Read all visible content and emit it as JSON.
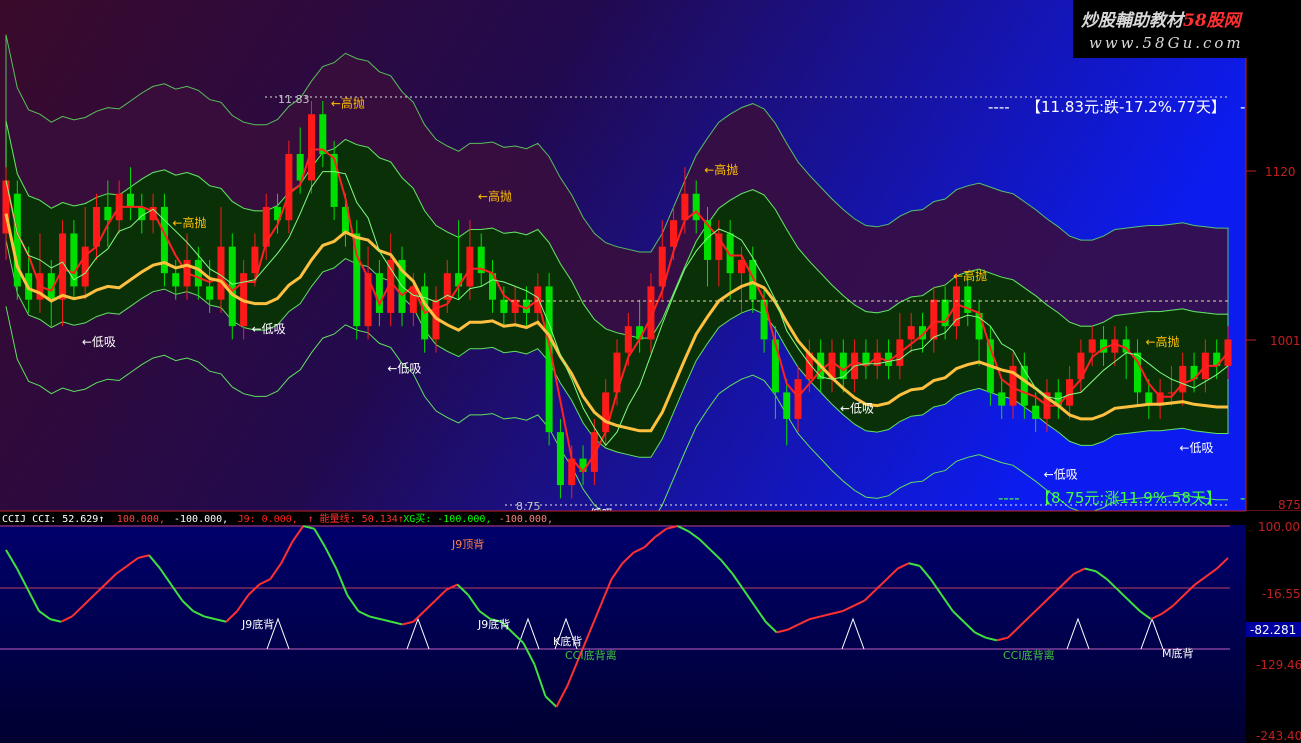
{
  "watermark": {
    "brand": "炒股輔助教材",
    "brand_accent": "58股网",
    "url": "www.58Gu.com"
  },
  "colors": {
    "up": "#ff1a1a",
    "down": "#00e000",
    "upper_band_fill": "#3a0e3c",
    "middle_band_fill": "#0a3008",
    "cci_up": "#ff3030",
    "cci_down": "#40e040",
    "ma_yellow": "#ffc040"
  },
  "main_panel": {
    "header_text": "",
    "annotations": [
      {
        "text": "11.83",
        "color": "#c0c0c0"
      },
      {
        "text": "8.75",
        "color": "#c0c0c0"
      },
      {
        "text": "高抛",
        "color": "#ffc000"
      },
      {
        "text": "低吸",
        "color": "#ffffff"
      }
    ],
    "top_marker": "【11.83元:跌-17.2%.77天】",
    "bottom_marker": "【8.75元:涨11.9%.58天】",
    "price_ticks": [
      "1120",
      "1001",
      "875"
    ]
  },
  "cci_panel": {
    "header_parts": [
      {
        "text": "CCIJ CCI: 52.629↑",
        "color": "#ffffff"
      },
      {
        "text": "100.000,",
        "color": "#ff4040"
      },
      {
        "text": "-100.000,",
        "color": "#ffffff"
      },
      {
        "text": "J9: 0.000,",
        "color": "#ff2020"
      },
      {
        "text": "↑ 能量线: 50.134↑",
        "color": "#ff3030"
      },
      {
        "text": "XG买: -100.000,",
        "color": "#00ff00"
      },
      {
        "text": "-100.000,",
        "color": "#ff8080"
      }
    ],
    "labels": [
      "J9顶背",
      "J9底背",
      "J9底背",
      "K底背",
      "CCI底背离",
      "CCI底背离",
      "M底背"
    ],
    "ticks": [
      "100.00",
      "-16.55",
      "-129.46",
      "-243.40"
    ],
    "current_value": "-82.281"
  },
  "chart_data": [
    {
      "type": "candlestick",
      "title": "",
      "y_label_ticks": [
        11.2,
        10.01,
        8.75
      ],
      "high_marker": 11.83,
      "low_marker": 8.75,
      "signals": [
        "高抛",
        "低吸"
      ],
      "candles": [
        [
          10.8,
          11.2,
          11.3,
          10.6
        ],
        [
          11.1,
          10.4,
          11.2,
          10.3
        ],
        [
          10.5,
          10.3,
          10.7,
          10.2
        ],
        [
          10.3,
          10.5,
          10.8,
          10.2
        ],
        [
          10.5,
          10.3,
          10.6,
          10.1
        ],
        [
          10.3,
          10.8,
          10.9,
          10.1
        ],
        [
          10.8,
          10.4,
          10.9,
          10.3
        ],
        [
          10.4,
          10.7,
          11.0,
          10.3
        ],
        [
          10.7,
          11.0,
          11.1,
          10.6
        ],
        [
          11.0,
          10.9,
          11.2,
          10.7
        ],
        [
          10.9,
          11.1,
          11.2,
          10.8
        ],
        [
          11.1,
          11.0,
          11.3,
          10.9
        ],
        [
          11.0,
          10.9,
          11.1,
          10.8
        ],
        [
          10.9,
          11.0,
          11.1,
          10.8
        ],
        [
          11.0,
          10.5,
          11.1,
          10.4
        ],
        [
          10.5,
          10.4,
          10.6,
          10.3
        ],
        [
          10.4,
          10.6,
          10.8,
          10.3
        ],
        [
          10.6,
          10.4,
          10.7,
          10.3
        ],
        [
          10.4,
          10.3,
          10.6,
          10.2
        ],
        [
          10.3,
          10.7,
          11.0,
          10.2
        ],
        [
          10.7,
          10.1,
          10.8,
          10.0
        ],
        [
          10.1,
          10.5,
          10.6,
          10.0
        ],
        [
          10.5,
          10.7,
          10.8,
          10.4
        ],
        [
          10.7,
          11.0,
          11.1,
          10.6
        ],
        [
          11.0,
          10.9,
          11.1,
          10.8
        ],
        [
          10.9,
          11.4,
          11.5,
          10.8
        ],
        [
          11.4,
          11.2,
          11.6,
          11.1
        ],
        [
          11.2,
          11.7,
          11.8,
          11.1
        ],
        [
          11.7,
          11.4,
          11.8,
          11.3
        ],
        [
          11.4,
          11.0,
          11.5,
          10.9
        ],
        [
          11.0,
          10.8,
          11.1,
          10.7
        ],
        [
          10.8,
          10.1,
          10.9,
          10.0
        ],
        [
          10.1,
          10.5,
          10.7,
          10.0
        ],
        [
          10.5,
          10.2,
          10.6,
          10.1
        ],
        [
          10.2,
          10.6,
          10.8,
          10.1
        ],
        [
          10.6,
          10.2,
          10.7,
          10.1
        ],
        [
          10.2,
          10.4,
          10.5,
          10.1
        ],
        [
          10.4,
          10.0,
          10.5,
          9.9
        ],
        [
          10.0,
          10.3,
          10.4,
          9.9
        ],
        [
          10.3,
          10.5,
          10.6,
          10.2
        ],
        [
          10.5,
          10.4,
          10.9,
          10.3
        ],
        [
          10.4,
          10.7,
          10.9,
          10.3
        ],
        [
          10.7,
          10.5,
          10.8,
          10.4
        ],
        [
          10.5,
          10.3,
          10.6,
          10.2
        ],
        [
          10.3,
          10.2,
          10.4,
          10.1
        ],
        [
          10.2,
          10.3,
          10.4,
          10.1
        ],
        [
          10.3,
          10.2,
          10.4,
          10.1
        ],
        [
          10.2,
          10.4,
          10.5,
          10.1
        ],
        [
          10.4,
          9.3,
          10.5,
          9.2
        ],
        [
          9.3,
          8.9,
          9.4,
          8.8
        ],
        [
          8.9,
          9.1,
          9.2,
          8.8
        ],
        [
          9.1,
          9.0,
          9.2,
          8.9
        ],
        [
          9.0,
          9.3,
          9.4,
          8.9
        ],
        [
          9.3,
          9.6,
          9.7,
          9.2
        ],
        [
          9.6,
          9.9,
          10.0,
          9.5
        ],
        [
          9.9,
          10.1,
          10.2,
          9.8
        ],
        [
          10.1,
          10.0,
          10.3,
          9.9
        ],
        [
          10.0,
          10.4,
          10.5,
          9.9
        ],
        [
          10.4,
          10.7,
          10.9,
          10.3
        ],
        [
          10.7,
          10.9,
          11.0,
          10.6
        ],
        [
          10.9,
          11.1,
          11.3,
          10.8
        ],
        [
          11.1,
          10.9,
          11.2,
          10.8
        ],
        [
          10.9,
          10.6,
          11.0,
          10.4
        ],
        [
          10.6,
          10.8,
          10.9,
          10.4
        ],
        [
          10.8,
          10.5,
          10.9,
          10.3
        ],
        [
          10.5,
          10.6,
          10.7,
          10.2
        ],
        [
          10.6,
          10.3,
          10.7,
          10.2
        ],
        [
          10.3,
          10.0,
          10.4,
          9.9
        ],
        [
          10.0,
          9.6,
          10.1,
          9.4
        ],
        [
          9.6,
          9.4,
          9.7,
          9.2
        ],
        [
          9.4,
          9.7,
          9.8,
          9.3
        ],
        [
          9.7,
          9.9,
          10.0,
          9.6
        ],
        [
          9.9,
          9.7,
          10.0,
          9.6
        ],
        [
          9.7,
          9.9,
          10.0,
          9.6
        ],
        [
          9.9,
          9.7,
          10.0,
          9.6
        ],
        [
          9.7,
          9.9,
          10.0,
          9.6
        ],
        [
          9.9,
          9.8,
          10.0,
          9.7
        ],
        [
          9.8,
          9.9,
          10.0,
          9.7
        ],
        [
          9.9,
          9.8,
          10.0,
          9.7
        ],
        [
          9.8,
          10.0,
          10.2,
          9.7
        ],
        [
          10.0,
          10.1,
          10.2,
          9.9
        ],
        [
          10.1,
          10.0,
          10.2,
          9.9
        ],
        [
          10.0,
          10.3,
          10.4,
          9.9
        ],
        [
          10.3,
          10.1,
          10.4,
          10.0
        ],
        [
          10.1,
          10.4,
          10.5,
          10.0
        ],
        [
          10.4,
          10.2,
          10.5,
          10.1
        ],
        [
          10.2,
          10.0,
          10.3,
          9.8
        ],
        [
          10.0,
          9.6,
          10.1,
          9.5
        ],
        [
          9.6,
          9.5,
          9.7,
          9.4
        ],
        [
          9.5,
          9.8,
          9.9,
          9.4
        ],
        [
          9.8,
          9.5,
          9.9,
          9.4
        ],
        [
          9.5,
          9.4,
          9.6,
          9.3
        ],
        [
          9.4,
          9.6,
          9.7,
          9.3
        ],
        [
          9.6,
          9.5,
          9.7,
          9.4
        ],
        [
          9.5,
          9.7,
          9.8,
          9.4
        ],
        [
          9.7,
          9.9,
          10.0,
          9.6
        ],
        [
          9.9,
          10.0,
          10.1,
          9.8
        ],
        [
          10.0,
          9.9,
          10.1,
          9.8
        ],
        [
          9.9,
          10.0,
          10.1,
          9.8
        ],
        [
          10.0,
          9.9,
          10.1,
          9.7
        ],
        [
          9.9,
          9.6,
          10.0,
          9.5
        ],
        [
          9.6,
          9.5,
          9.7,
          9.4
        ],
        [
          9.5,
          9.6,
          9.7,
          9.4
        ],
        [
          9.6,
          9.6,
          9.8,
          9.5
        ],
        [
          9.6,
          9.8,
          9.9,
          9.5
        ],
        [
          9.8,
          9.7,
          9.9,
          9.6
        ],
        [
          9.7,
          9.9,
          10.0,
          9.6
        ],
        [
          9.9,
          9.8,
          10.0,
          9.7
        ],
        [
          9.8,
          10.0,
          10.1,
          9.7
        ]
      ]
    },
    {
      "type": "line",
      "title": "",
      "series": [
        {
          "name": "CCI",
          "values": [
            55,
            20,
            -20,
            -60,
            -75,
            -80,
            -70,
            -50,
            -30,
            -10,
            10,
            25,
            40,
            45,
            20,
            -10,
            -40,
            -60,
            -70,
            -75,
            -80,
            -60,
            -30,
            -10,
            0,
            30,
            70,
            100,
            95,
            60,
            20,
            -30,
            -60,
            -70,
            -75,
            -80,
            -85,
            -80,
            -60,
            -40,
            -20,
            -10,
            -30,
            -60,
            -75,
            -80,
            -100,
            -120,
            -160,
            -220,
            -240,
            -200,
            -150,
            -100,
            -50,
            0,
            30,
            50,
            60,
            80,
            95,
            100,
            90,
            75,
            55,
            35,
            10,
            -20,
            -50,
            -80,
            -100,
            -95,
            -85,
            -75,
            -70,
            -65,
            -60,
            -50,
            -40,
            -20,
            0,
            20,
            30,
            25,
            0,
            -30,
            -60,
            -80,
            -100,
            -110,
            -115,
            -110,
            -90,
            -70,
            -50,
            -30,
            -10,
            10,
            20,
            15,
            0,
            -20,
            -40,
            -60,
            -75,
            -65,
            -50,
            -30,
            -10,
            5,
            20,
            40
          ]
        }
      ],
      "y_ticks": [
        100.0,
        -16.55,
        -129.46,
        -243.4
      ],
      "current_value": -82.281
    }
  ]
}
